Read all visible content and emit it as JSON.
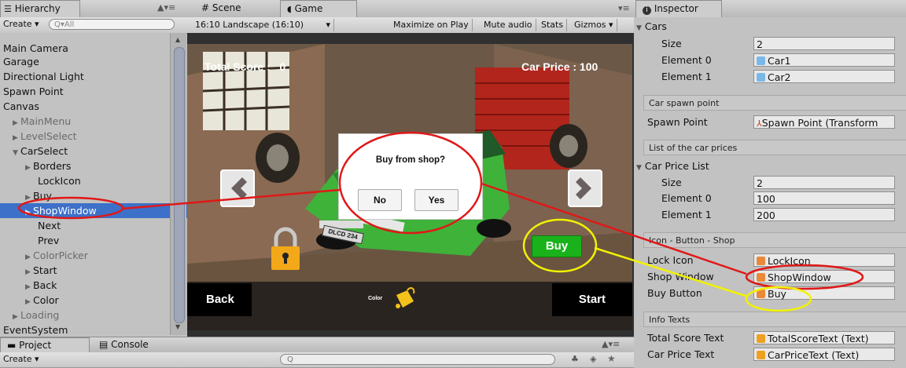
{
  "hierarchy": {
    "tab_label": "Hierarchy",
    "create_label": "Create",
    "search_placeholder": "Q▾All",
    "items": [
      {
        "label": "Main Camera"
      },
      {
        "label": "Garage"
      },
      {
        "label": "Directional Light"
      },
      {
        "label": "Spawn Point"
      },
      {
        "label": "Canvas"
      },
      {
        "label": "MainMenu"
      },
      {
        "label": "LevelSelect"
      },
      {
        "label": "CarSelect"
      },
      {
        "label": "Borders"
      },
      {
        "label": "LockIcon"
      },
      {
        "label": "Buy"
      },
      {
        "label": "ShopWindow"
      },
      {
        "label": "Next"
      },
      {
        "label": "Prev"
      },
      {
        "label": "ColorPicker"
      },
      {
        "label": "Start"
      },
      {
        "label": "Back"
      },
      {
        "label": "Color"
      },
      {
        "label": "Loading"
      },
      {
        "label": "EventSystem"
      }
    ]
  },
  "scene_tabs": {
    "scene": "Scene",
    "game": "Game"
  },
  "game_toolbar": {
    "aspect": "16:10 Landscape (16:10)",
    "maximize": "Maximize on Play",
    "mute": "Mute audio",
    "stats": "Stats",
    "gizmos": "Gizmos"
  },
  "game": {
    "total_score": "Total Score :   0",
    "car_price": "Car Price : 100",
    "dialog_title": "Buy from shop?",
    "no": "No",
    "yes": "Yes",
    "buy": "Buy",
    "back": "Back",
    "start": "Start",
    "color": "Color",
    "plate": "DLCD 234"
  },
  "inspector": {
    "tab_label": "Inspector",
    "cars_label": "Cars",
    "size_label": "Size",
    "cars_size": "2",
    "element0_label": "Element 0",
    "element1_label": "Element 1",
    "car1": "Car1",
    "car2": "Car2",
    "spawn_header": "Car spawn point",
    "spawn_label": "Spawn Point",
    "spawn_value": "Spawn Point (Transform",
    "prices_header": "List of the car prices",
    "price_list_label": "Car Price List",
    "price_size": "2",
    "price0": "100",
    "price1": "200",
    "icon_header": "Icon - Button - Shop",
    "lock_label": "Lock Icon",
    "lock_value": "LockIcon",
    "shop_label": "Shop Window",
    "shop_value": "ShopWindow",
    "buy_label": "Buy Button",
    "buy_value": "Buy",
    "info_header": "Info Texts",
    "total_label": "Total Score Text",
    "total_value": "TotalScoreText (Text)",
    "price_label": "Car Price Text",
    "price_value": "CarPriceText (Text)"
  },
  "bottom": {
    "project": "Project",
    "console": "Console",
    "create": "Create"
  }
}
